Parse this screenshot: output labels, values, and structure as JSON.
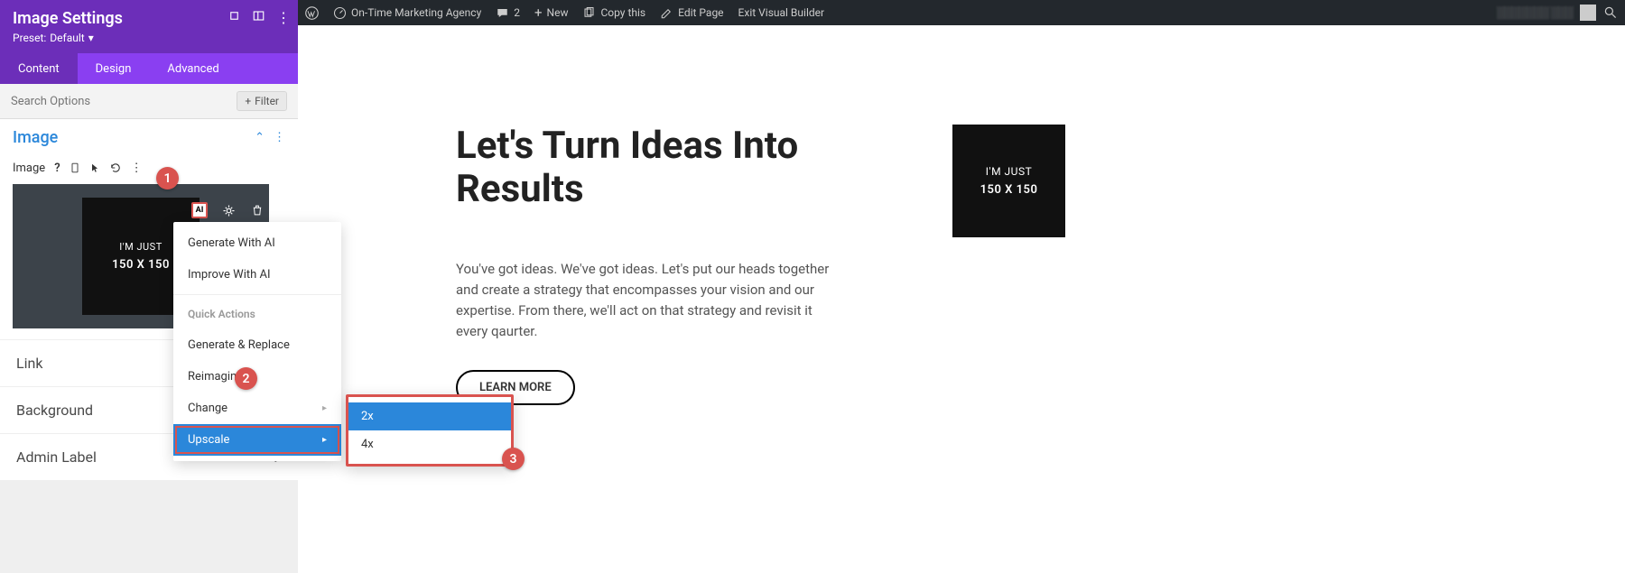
{
  "admin_bar": {
    "site_name": "On-Time Marketing Agency",
    "comment_count": "2",
    "new_label": "New",
    "copy_this": "Copy this",
    "edit_page": "Edit Page",
    "exit_builder": "Exit Visual Builder",
    "user_blur": "░░░░░░░ ░░░"
  },
  "sidebar": {
    "title": "Image Settings",
    "preset_prefix": "Preset:",
    "preset_value": "Default",
    "tabs": {
      "content": "Content",
      "design": "Design",
      "advanced": "Advanced"
    },
    "search_placeholder": "Search Options",
    "filter_label": "Filter",
    "section": {
      "title": "Image",
      "field_label": "Image"
    },
    "preview": {
      "line1": "I'M JUST",
      "line2": "150 X 150",
      "ai_label": "AI"
    },
    "collapsed": {
      "link": "Link",
      "background": "Background",
      "admin_label": "Admin Label"
    }
  },
  "ai_menu": {
    "generate": "Generate With AI",
    "improve": "Improve With AI",
    "quick_actions": "Quick Actions",
    "generate_replace": "Generate & Replace",
    "reimagine": "Reimagine",
    "change": "Change",
    "upscale": "Upscale",
    "submenu": {
      "x2": "2x",
      "x4": "4x"
    }
  },
  "badges": {
    "b1": "1",
    "b2": "2",
    "b3": "3"
  },
  "page": {
    "hero_title": "Let's Turn Ideas Into Results",
    "hero_body": "You've got ideas. We've got ideas. Let's put our heads together and create a strategy that encompasses your vision and our expertise. From there, we'll act on that strategy and revisit it every qaurter.",
    "learn_more": "LEARN MORE",
    "img_line1": "I'M JUST",
    "img_line2": "150 X 150"
  },
  "icons": {
    "chevron_down": "▾",
    "more_v": "⋮",
    "plus": "+",
    "arrow_right": "▸",
    "filter_plus": "+",
    "collapse_up": "⌃"
  }
}
